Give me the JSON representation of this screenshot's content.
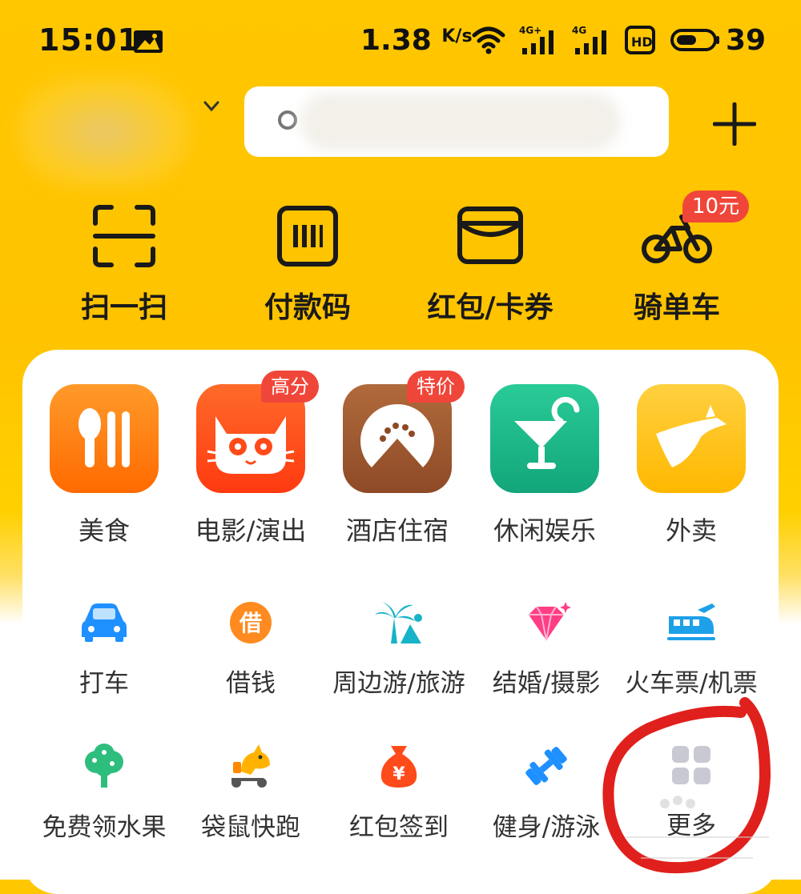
{
  "status_bar": {
    "time": "15:01",
    "net_speed": "1.38",
    "net_speed_unit": "K/s",
    "sim1_label": "4G+",
    "sim2_label": "4G",
    "hd_label": "HD",
    "battery": "39"
  },
  "header": {
    "search_placeholder": ""
  },
  "quick_actions": [
    {
      "label": "扫一扫",
      "icon": "scan-icon"
    },
    {
      "label": "付款码",
      "icon": "barcode-icon"
    },
    {
      "label": "红包/卡券",
      "icon": "wallet-icon"
    },
    {
      "label": "骑单车",
      "icon": "bicycle-icon",
      "badge": "10元"
    }
  ],
  "categories": [
    {
      "label": "美食",
      "icon": "utensils-icon",
      "color": "#FF7A10"
    },
    {
      "label": "电影/演出",
      "icon": "cat-face-icon",
      "color": "#FF4A1A",
      "badge": "高分"
    },
    {
      "label": "酒店住宿",
      "icon": "hotel-icon",
      "color": "#A0522D",
      "badge": "特价"
    },
    {
      "label": "休闲娱乐",
      "icon": "cocktail-icon",
      "color": "#1DB58A"
    },
    {
      "label": "外卖",
      "icon": "kangaroo-icon",
      "color": "#FFC21A"
    }
  ],
  "services_row1": [
    {
      "label": "打车",
      "icon": "car-icon"
    },
    {
      "label": "借钱",
      "icon": "loan-icon",
      "glyph": "借"
    },
    {
      "label": "周边游/旅游",
      "icon": "palm-tree-icon"
    },
    {
      "label": "结婚/摄影",
      "icon": "diamond-icon"
    },
    {
      "label": "火车票/机票",
      "icon": "train-icon"
    }
  ],
  "services_row2": [
    {
      "label": "免费领水果",
      "icon": "fruit-tree-icon"
    },
    {
      "label": "袋鼠快跑",
      "icon": "kangaroo-scooter-icon"
    },
    {
      "label": "红包签到",
      "icon": "money-bag-icon",
      "glyph": "¥"
    },
    {
      "label": "健身/游泳",
      "icon": "dumbbell-icon"
    },
    {
      "label": "更多",
      "icon": "grid-icon"
    }
  ],
  "colors": {
    "brand_yellow": "#FFC300",
    "badge_red": "#F0463A",
    "annotation_red": "#E0201C"
  }
}
